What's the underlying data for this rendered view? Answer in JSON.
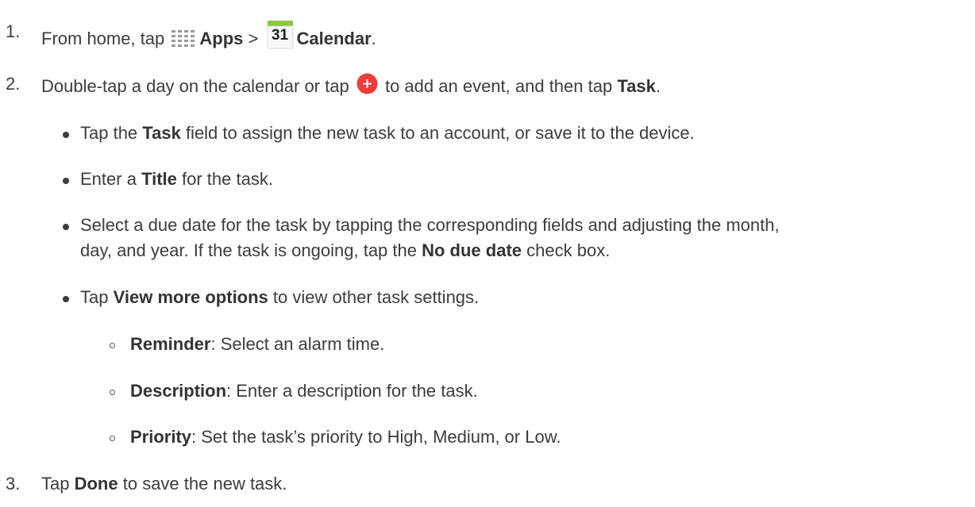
{
  "steps": [
    {
      "number": "1.",
      "parts": {
        "before_apps": "From home, tap",
        "apps": "Apps",
        "separator": ">",
        "calendar_icon_text": "31",
        "calendar": "Calendar",
        "end": "."
      }
    },
    {
      "number": "2.",
      "parts": {
        "before_icon": "Double-tap a day on the calendar or tap",
        "after_icon": "to add an event, and then tap",
        "task": "Task",
        "end": "."
      }
    },
    {
      "number": "3.",
      "parts": {
        "before": "Tap",
        "done": "Done",
        "after": "to save the new task."
      }
    }
  ],
  "bullets": [
    {
      "pre": "Tap the",
      "bold": "Task",
      "post": "field to assign the new task to an account, or save it to the device."
    },
    {
      "pre": "Enter a",
      "bold": "Title",
      "post": "for the task."
    },
    {
      "line1": "Select a due date for the task by tapping the corresponding fields and adjusting the month,",
      "line2_pre": "day, and year. If the task is ongoing, tap the",
      "line2_bold": "No due date",
      "line2_post": "check box."
    },
    {
      "pre": "Tap",
      "bold": "View more options",
      "post": "to view other task settings."
    }
  ],
  "sub_bullets": [
    {
      "bold": "Reminder",
      "post": ": Select an alarm time."
    },
    {
      "bold": "Description",
      "post": ": Enter a description for the task."
    },
    {
      "bold": "Priority",
      "post": ": Set the task’s priority to High, Medium, or Low."
    }
  ],
  "icons": {
    "apps": "apps-grid-icon",
    "calendar": "calendar-icon",
    "add": "add-event-icon"
  },
  "colors": {
    "add_icon": "#ee3b3b",
    "calendar_top": "#8dc63f",
    "apps_grid": "#9a9a9a"
  }
}
